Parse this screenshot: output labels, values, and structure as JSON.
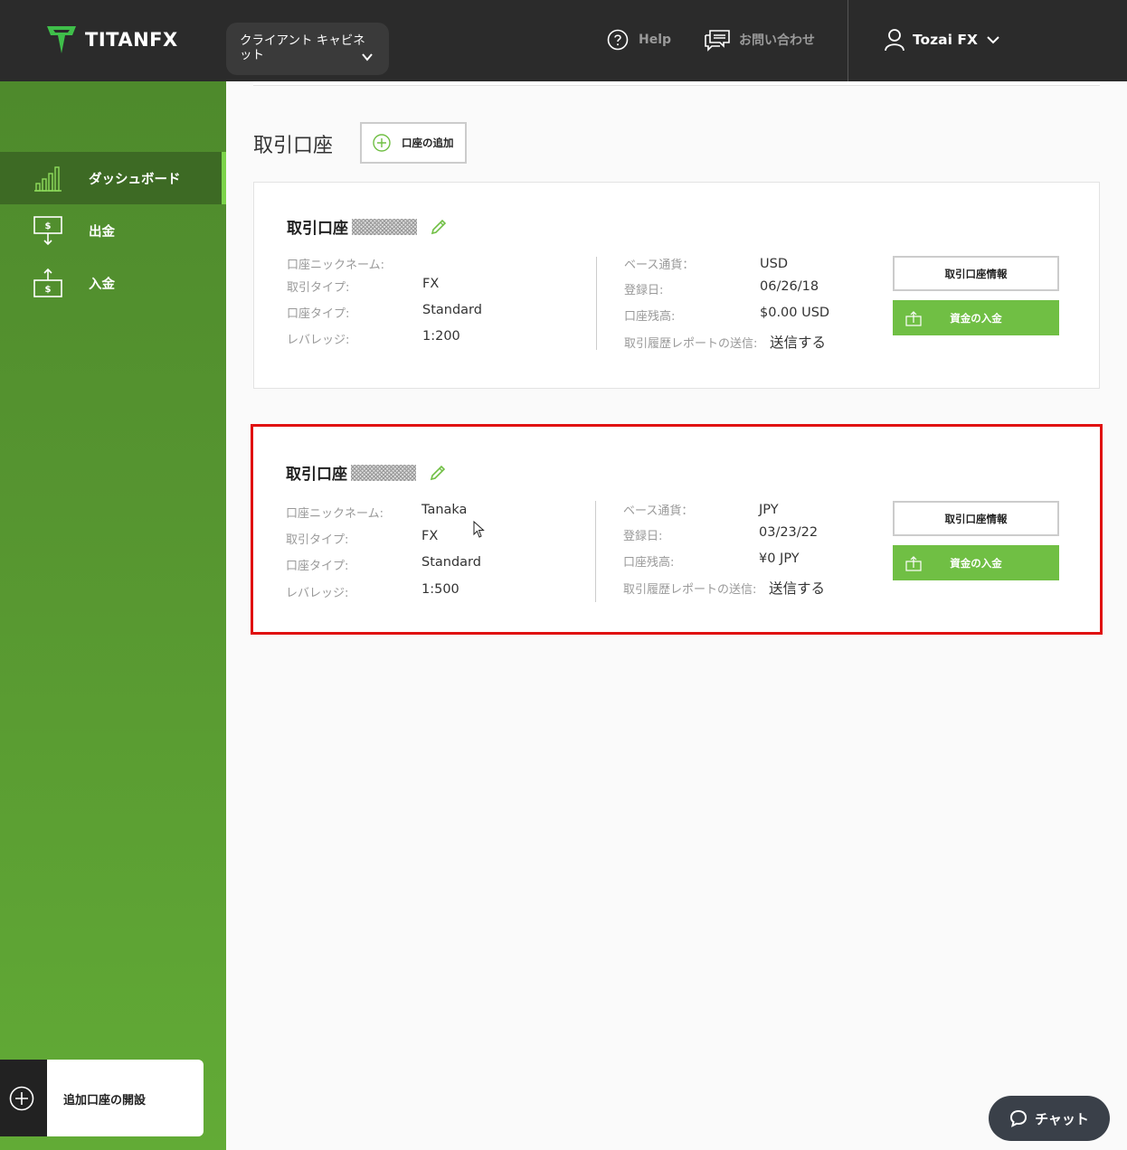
{
  "header": {
    "logo_text": "TITANFX",
    "cabinet_label": "クライアント キャビネット",
    "help_label": "Help",
    "contact_label": "お問い合わせ",
    "user_name": "Tozai FX"
  },
  "sidebar": {
    "items": [
      {
        "label": "ダッシュボード",
        "icon": "chart-bars-icon",
        "active": true
      },
      {
        "label": "出金",
        "icon": "withdraw-icon",
        "active": false
      },
      {
        "label": "入金",
        "icon": "deposit-icon",
        "active": false
      }
    ],
    "open_account_label": "追加口座の開設"
  },
  "main": {
    "section_title": "取引口座",
    "add_account_label": "口座の追加",
    "accounts": [
      {
        "title": "取引口座",
        "nickname_label": "口座ニックネーム:",
        "nickname": "",
        "trade_type_label": "取引タイプ:",
        "trade_type": "FX",
        "account_type_label": "口座タイプ:",
        "account_type": "Standard",
        "leverage_label": "レバレッジ:",
        "leverage": "1:200",
        "currency_label": "ベース通貨：",
        "currency": "USD",
        "registered_label": "登録日:",
        "registered": "06/26/18",
        "balance_label": "口座残高:",
        "balance": "$0.00 USD",
        "report_label": "取引履歴レポートの送信:",
        "report": "送信する",
        "info_button": "取引口座情報",
        "deposit_button": "資金の入金"
      },
      {
        "title": "取引口座",
        "nickname_label": "口座ニックネーム:",
        "nickname": "Tanaka",
        "trade_type_label": "取引タイプ:",
        "trade_type": "FX",
        "account_type_label": "口座タイプ:",
        "account_type": "Standard",
        "leverage_label": "レバレッジ:",
        "leverage": "1:500",
        "currency_label": "ベース通貨：",
        "currency": "JPY",
        "registered_label": "登録日:",
        "registered": "03/23/22",
        "balance_label": "口座残高:",
        "balance": "¥0 JPY",
        "report_label": "取引履歴レポートの送信:",
        "report": "送信する",
        "info_button": "取引口座情報",
        "deposit_button": "資金の入金"
      }
    ]
  },
  "chat_label": "チャット",
  "colors": {
    "accent_green": "#70bf44",
    "topbar": "#2b2b2b",
    "highlight_red": "#e01010"
  }
}
